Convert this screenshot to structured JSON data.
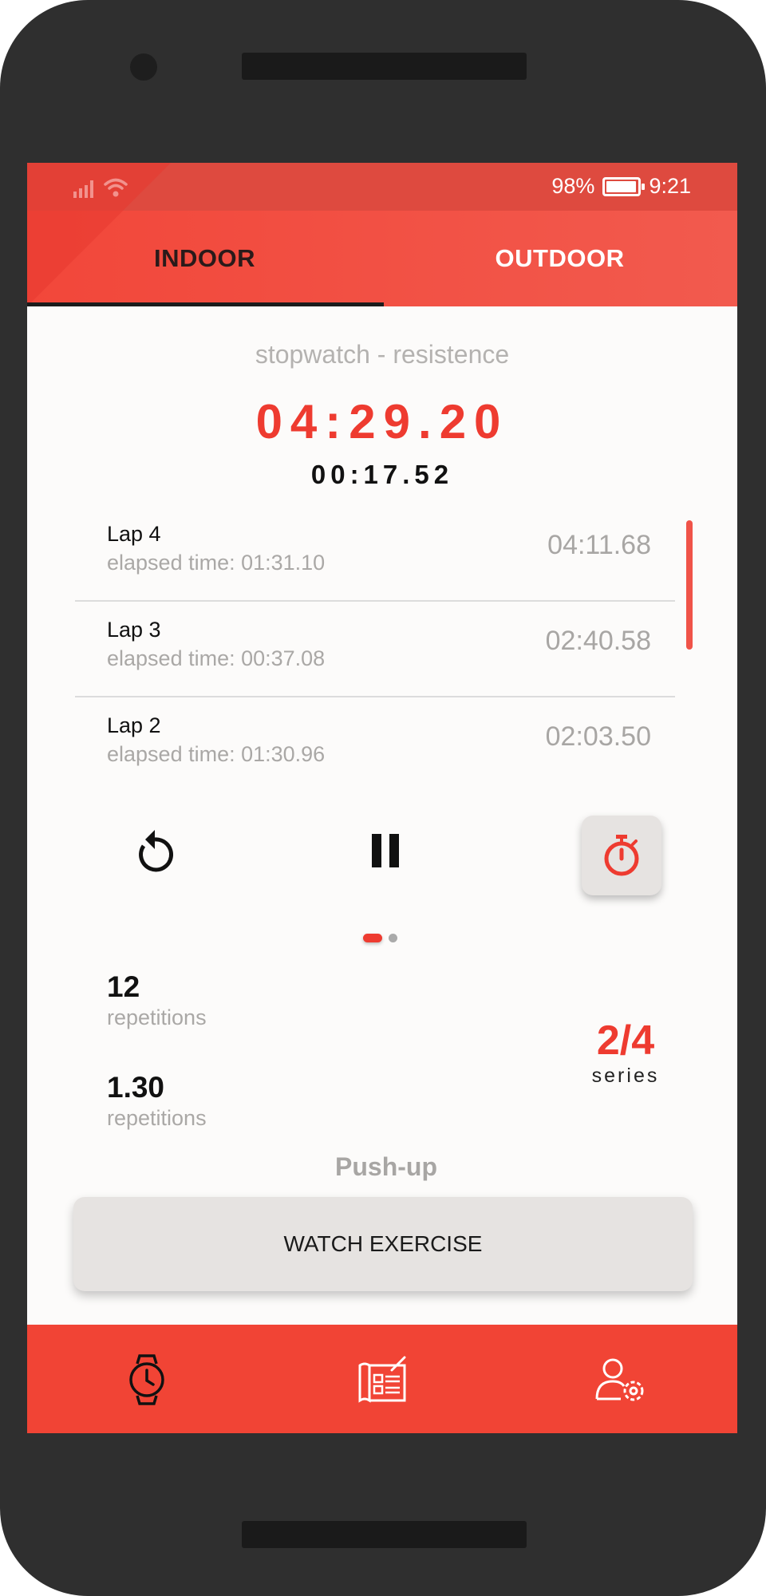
{
  "status_bar": {
    "battery_text": "98%",
    "battery_level": 0.98,
    "time": "9:21",
    "icons": [
      "signal-icon",
      "wifi-icon",
      "battery-icon"
    ]
  },
  "tabs": [
    {
      "label": "INDOOR",
      "selected": true
    },
    {
      "label": "OUTDOOR",
      "selected": false
    }
  ],
  "stopwatch": {
    "mode": "stopwatch - resistence",
    "main_time": "04:29.20",
    "sub_time": "00:17.52"
  },
  "laps": [
    {
      "title": "Lap 4",
      "elapsed": "elapsed time: 01:31.10",
      "time": "04:11.68"
    },
    {
      "title": "Lap 3",
      "elapsed": "elapsed time: 00:37.08",
      "time": "02:40.58"
    },
    {
      "title": "Lap 2",
      "elapsed": "elapsed time: 01:30.96",
      "time": "02:03.50"
    }
  ],
  "controls": {
    "icons": [
      "reset-icon",
      "pause-icon",
      "stopwatch-icon"
    ]
  },
  "pager": {
    "current": 1,
    "total": 2
  },
  "stats": [
    {
      "value": "12",
      "label": "repetitions"
    },
    {
      "value": "1.30",
      "label": "repetitions"
    }
  ],
  "series": {
    "value": "2/4",
    "label": "series"
  },
  "exercise": {
    "name": "Push-up",
    "button_label": "WATCH EXERCISE"
  },
  "bottom_nav": {
    "icons": [
      "watch-icon",
      "training-plan-icon",
      "user-settings-icon"
    ]
  },
  "colors": {
    "accent": "#ee3b30",
    "tab_bar": "#f2473a",
    "status_bar": "#de4a3f",
    "nav_bar": "#f14435"
  }
}
